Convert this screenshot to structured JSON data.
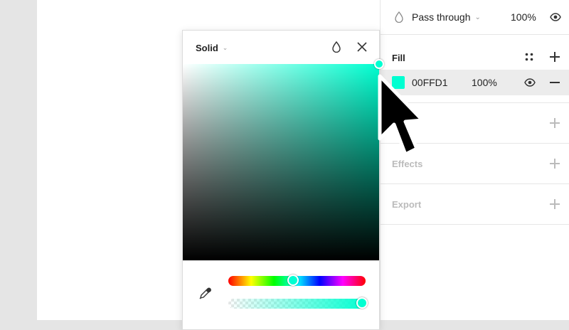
{
  "layer": {
    "blend_mode": "Pass through",
    "opacity": "100%"
  },
  "fill": {
    "title": "Fill",
    "hex": "00FFD1",
    "opacity": "100%",
    "color": "#00ffd1"
  },
  "effects": {
    "title": "Effects"
  },
  "export": {
    "title": "Export"
  },
  "picker": {
    "mode": "Solid"
  },
  "colors": {
    "accent": "#00ffd1",
    "panel_bg": "#ffffff",
    "chrome_bg": "#e5e5e5"
  }
}
